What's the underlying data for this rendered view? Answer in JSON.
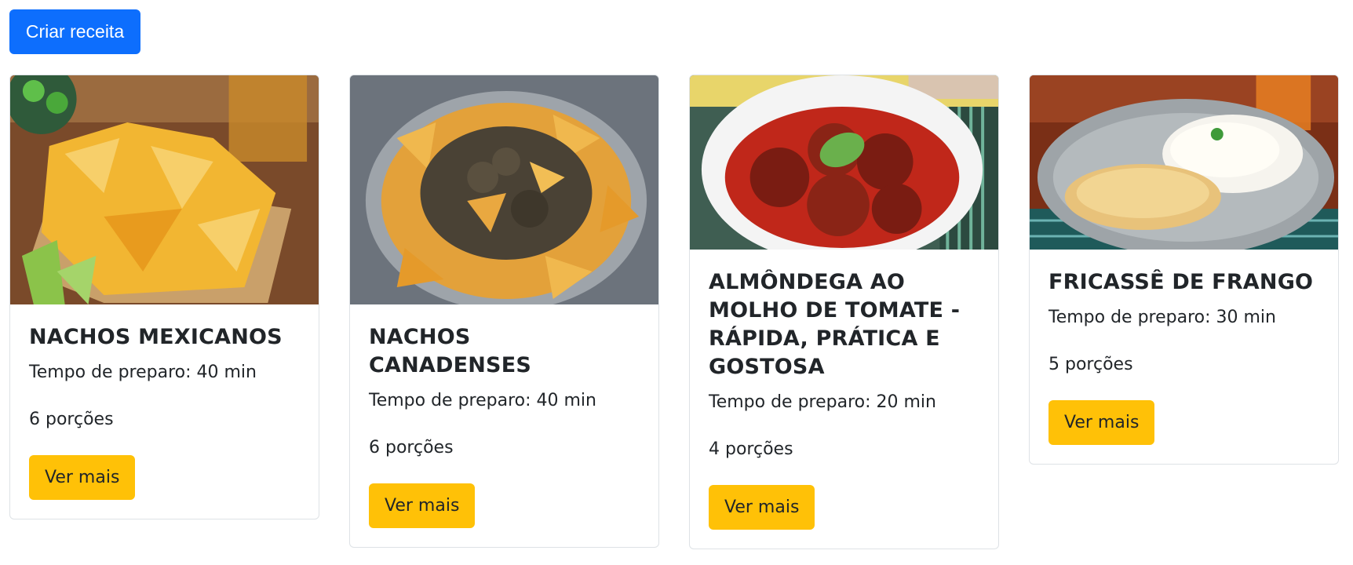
{
  "toolbar": {
    "create_label": "Criar receita"
  },
  "recipes": [
    {
      "title": "NACHOS MEXICANOS",
      "prep_time": "Tempo de preparo: 40 min",
      "servings": "6 porções",
      "button_label": "Ver mais",
      "image_icon": "nachos-cheese-image"
    },
    {
      "title": "NACHOS CANADENSES",
      "prep_time": "Tempo de preparo: 40 min",
      "servings": "6 porções",
      "button_label": "Ver mais",
      "image_icon": "nachos-ground-beef-image"
    },
    {
      "title": "ALMÔNDEGA AO MOLHO DE TOMATE - RÁPIDA, PRÁTICA E GOSTOSA",
      "prep_time": "Tempo de preparo: 20 min",
      "servings": "4 porções",
      "button_label": "Ver mais",
      "image_icon": "meatballs-tomato-sauce-image"
    },
    {
      "title": "FRICASSÊ DE FRANGO",
      "prep_time": "Tempo de preparo: 30 min",
      "servings": "5 porções",
      "button_label": "Ver mais",
      "image_icon": "chicken-fricassee-image"
    }
  ],
  "colors": {
    "primary": "#0d6efd",
    "warning": "#ffc107",
    "text": "#212529",
    "border": "#dee2e6"
  }
}
